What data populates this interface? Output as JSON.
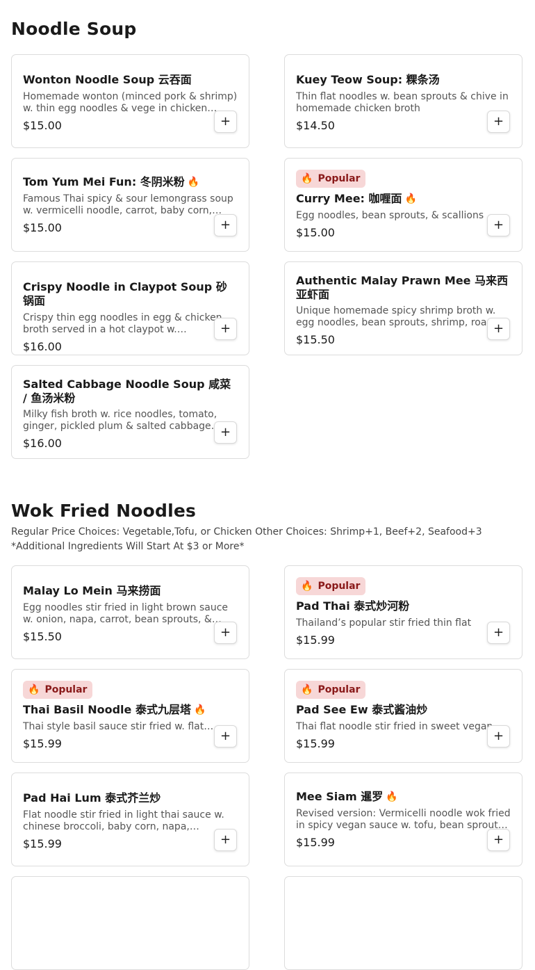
{
  "sections": [
    {
      "title": "Noodle Soup",
      "items": [
        {
          "name": "Wonton Noodle Soup 云吞面",
          "desc": "Homemade wonton (minced pork & shrimp) w. thin egg noodles & vege in chicken…",
          "price": "$15.00"
        },
        {
          "name": "Kuey Teow Soup: 粿条汤",
          "desc": "Thin flat noodles w. bean sprouts & chive in homemade chicken broth",
          "price": "$14.50"
        },
        {
          "name": "Tom Yum Mei Fun: 冬阴米粉",
          "desc": "Famous Thai spicy & sour lemongrass soup w. vermicelli noodle, carrot, baby corn,…",
          "price": "$15.00",
          "spicy": true
        },
        {
          "name": "Curry Mee: 咖喱面",
          "desc": "Egg noodles, bean sprouts, & scallions",
          "price": "$15.00",
          "spicy": true,
          "badge": "Popular"
        },
        {
          "name": "Crispy Noodle in Claypot Soup 砂锅面",
          "desc": "Crispy thin egg noodles in egg & chicken broth served in a hot claypot w. vegetable…",
          "price": "$16.00"
        },
        {
          "name": "Authentic Malay Prawn Mee 马来西亚虾面",
          "desc": "Unique homemade spicy shrimp broth w. egg noodles, bean sprouts, shrimp, roa…",
          "price": "$15.50"
        },
        {
          "name": "Salted Cabbage Noodle Soup 咸菜 / 鱼汤米粉",
          "desc": "Milky fish broth w. rice noodles, tomato, ginger, pickled plum & salted cabbage…",
          "price": "$16.00"
        }
      ]
    },
    {
      "title": "Wok Fried Noodles",
      "subtitle": "Regular Price Choices: Vegetable,Tofu, or Chicken Other Choices: Shrimp+1, Beef+2, Seafood+3",
      "note": "*Additional Ingredients Will Start At $3 or More*",
      "items": [
        {
          "name": "Malay Lo Mein 马来捞面",
          "desc": "Egg noodles stir fried in light brown sauce w. onion, napa, carrot, bean sprouts, & egg…",
          "price": "$15.50"
        },
        {
          "name": "Pad Thai 泰式炒河粉",
          "desc": "Thailand’s popular stir fried thin flat noodle…",
          "price": "$15.99",
          "badge": "Popular"
        },
        {
          "name": "Thai Basil Noodle 泰式九层塔",
          "desc": "Thai style basil sauce stir fried w. flat…",
          "price": "$15.99",
          "spicy": true,
          "badge": "Popular"
        },
        {
          "name": "Pad See Ew 泰式酱油炒",
          "desc": "Thai flat noodle stir fried in sweet vegan…",
          "price": "$15.99",
          "badge": "Popular"
        },
        {
          "name": "Pad Hai Lum 泰式芥兰炒",
          "desc": "Flat noodle stir fried in light thai sauce w. chinese broccoli, baby corn, napa, scallion…",
          "price": "$15.99"
        },
        {
          "name": "Mee Siam 暹罗",
          "desc": "Revised version: Vermicelli noodle wok fried in spicy vegan sauce w. tofu, bean sprout…",
          "price": "$15.99",
          "spicy": true
        }
      ]
    }
  ],
  "icons": {
    "popular": "fire-icon",
    "spicy": "chili-flame-icon",
    "add": "plus-icon"
  },
  "labels": {
    "add": "+"
  },
  "colors": {
    "badge_bg": "#f7d7d7",
    "badge_text": "#8a1a1a",
    "spicy": "#c0392b"
  }
}
